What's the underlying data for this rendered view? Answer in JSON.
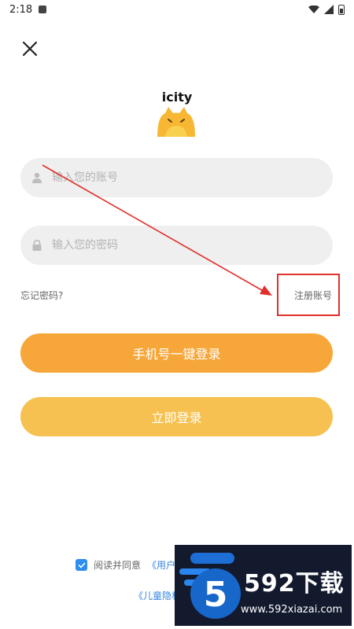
{
  "status_bar": {
    "time": "2:18"
  },
  "logo": {
    "text": "icity"
  },
  "account_input": {
    "placeholder": "输入您的账号"
  },
  "password_input": {
    "placeholder": "输入您的密码"
  },
  "links": {
    "forgot": "忘记密码?",
    "register": "注册账号"
  },
  "buttons": {
    "phone_login": "手机号一键登录",
    "login": "立即登录"
  },
  "agreement": {
    "prefix": "阅读并同意",
    "user_link": "《用户",
    "privacy_link": "《儿童隐私"
  },
  "watermark": {
    "brand": "592下载",
    "url": "www.592xiazai.com"
  },
  "colors": {
    "primary_button": "#f7a73a",
    "secondary_button": "#f6c151",
    "annotation": "#e0302c",
    "checkbox": "#2f8df0"
  }
}
